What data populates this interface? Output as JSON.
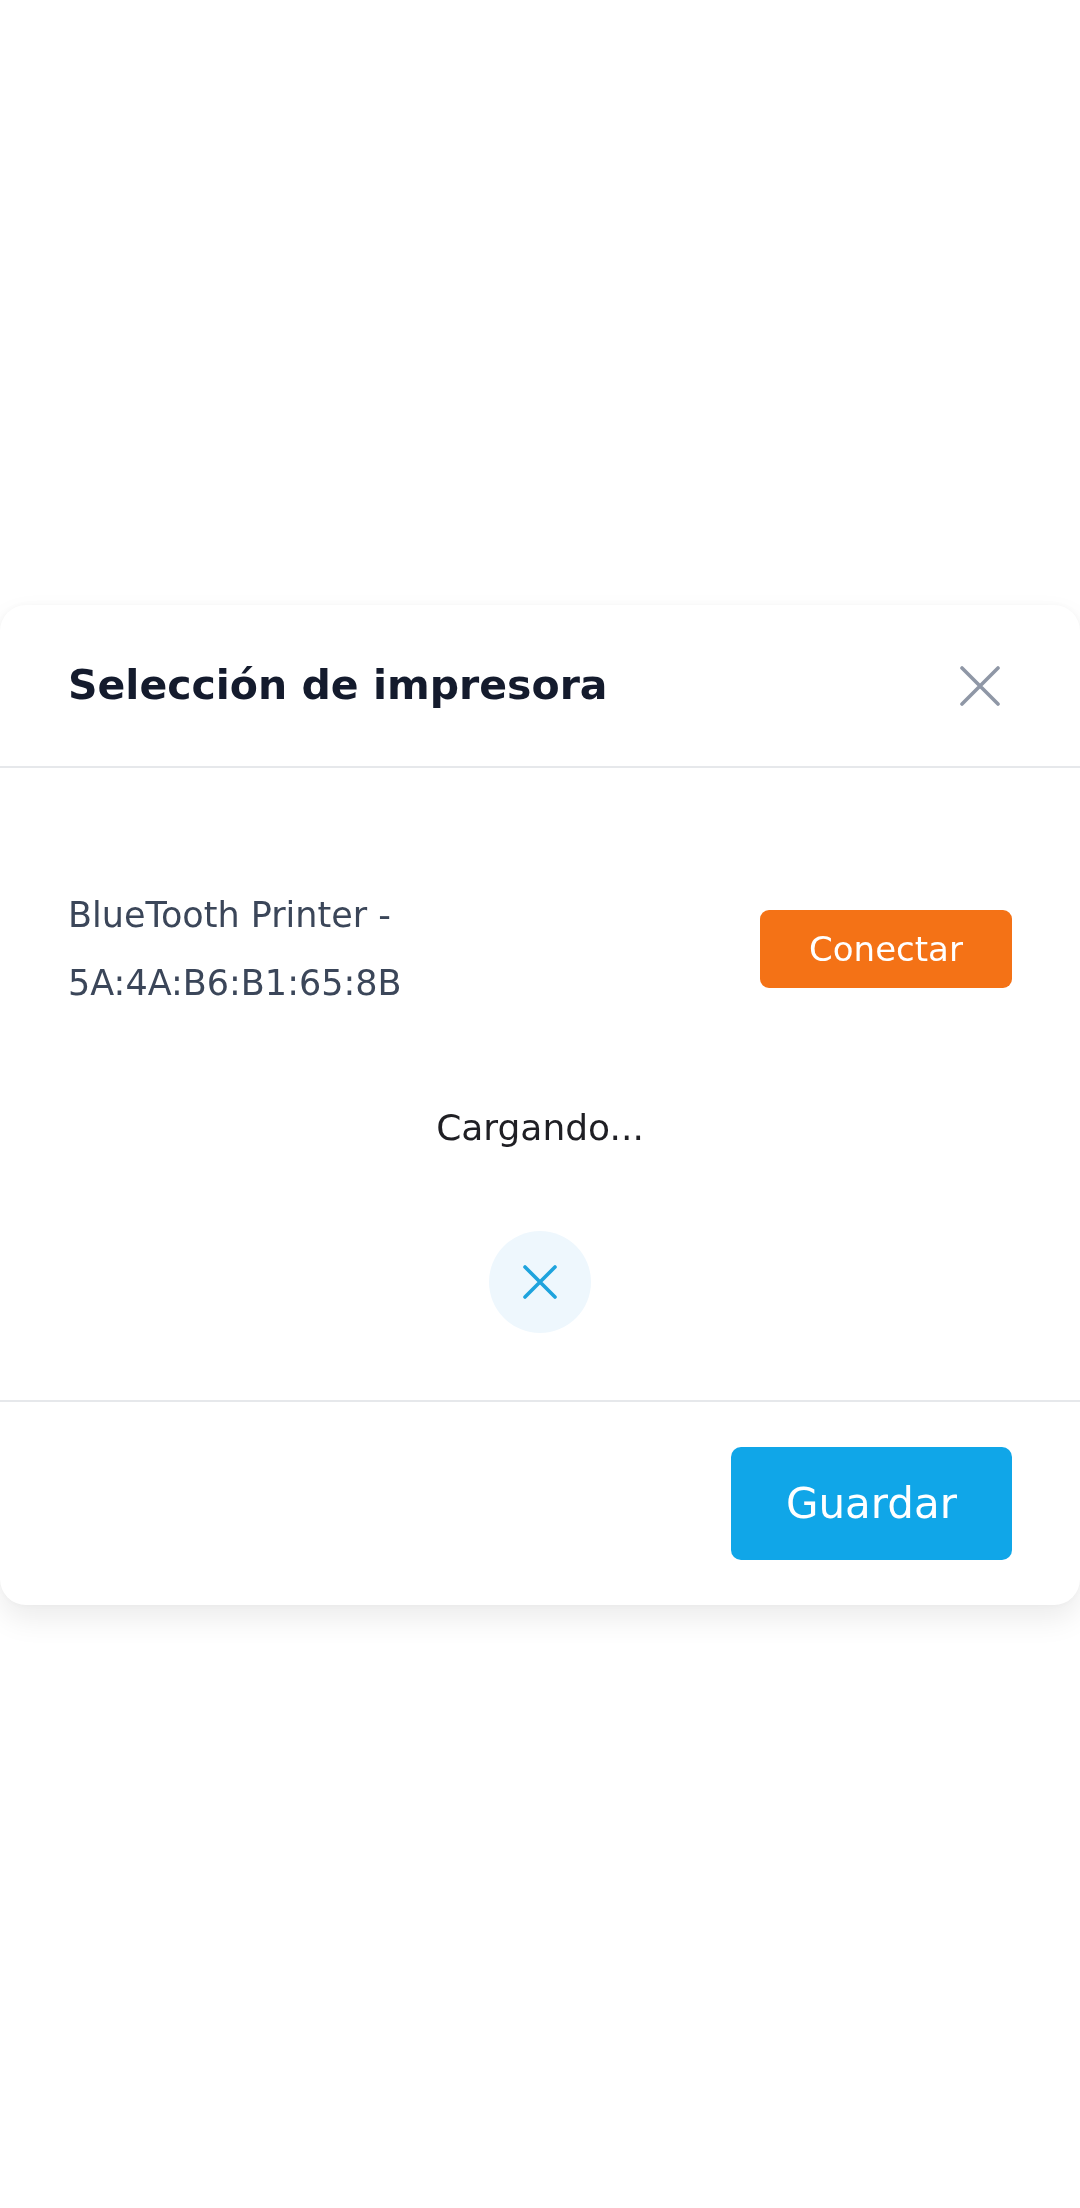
{
  "dialog": {
    "title": "Selección de impresora"
  },
  "devices": [
    {
      "name": "BlueTooth Printer - 5A:4A:B6:B1:65:8B",
      "action": "Conectar"
    }
  ],
  "status": {
    "text": "Cargando..."
  },
  "footer": {
    "buttons": [
      "Guardar"
    ]
  }
}
